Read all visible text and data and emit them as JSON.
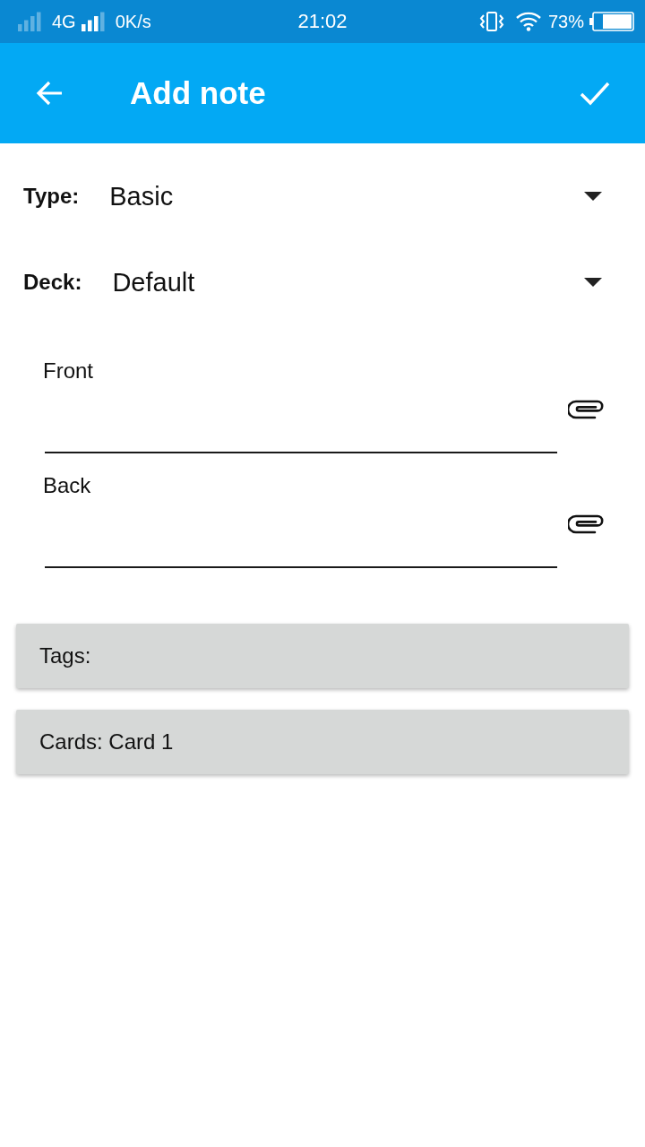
{
  "status_bar": {
    "network": "4G",
    "speed": "0K/s",
    "time": "21:02",
    "battery": "73%"
  },
  "app_bar": {
    "title": "Add note"
  },
  "selectors": [
    {
      "label": "Type:",
      "value": "Basic"
    },
    {
      "label": "Deck:",
      "value": "Default"
    }
  ],
  "fields": [
    {
      "label": "Front"
    },
    {
      "label": "Back"
    }
  ],
  "buttons": [
    {
      "label": "Tags:"
    },
    {
      "label": "Cards: Card 1"
    }
  ]
}
